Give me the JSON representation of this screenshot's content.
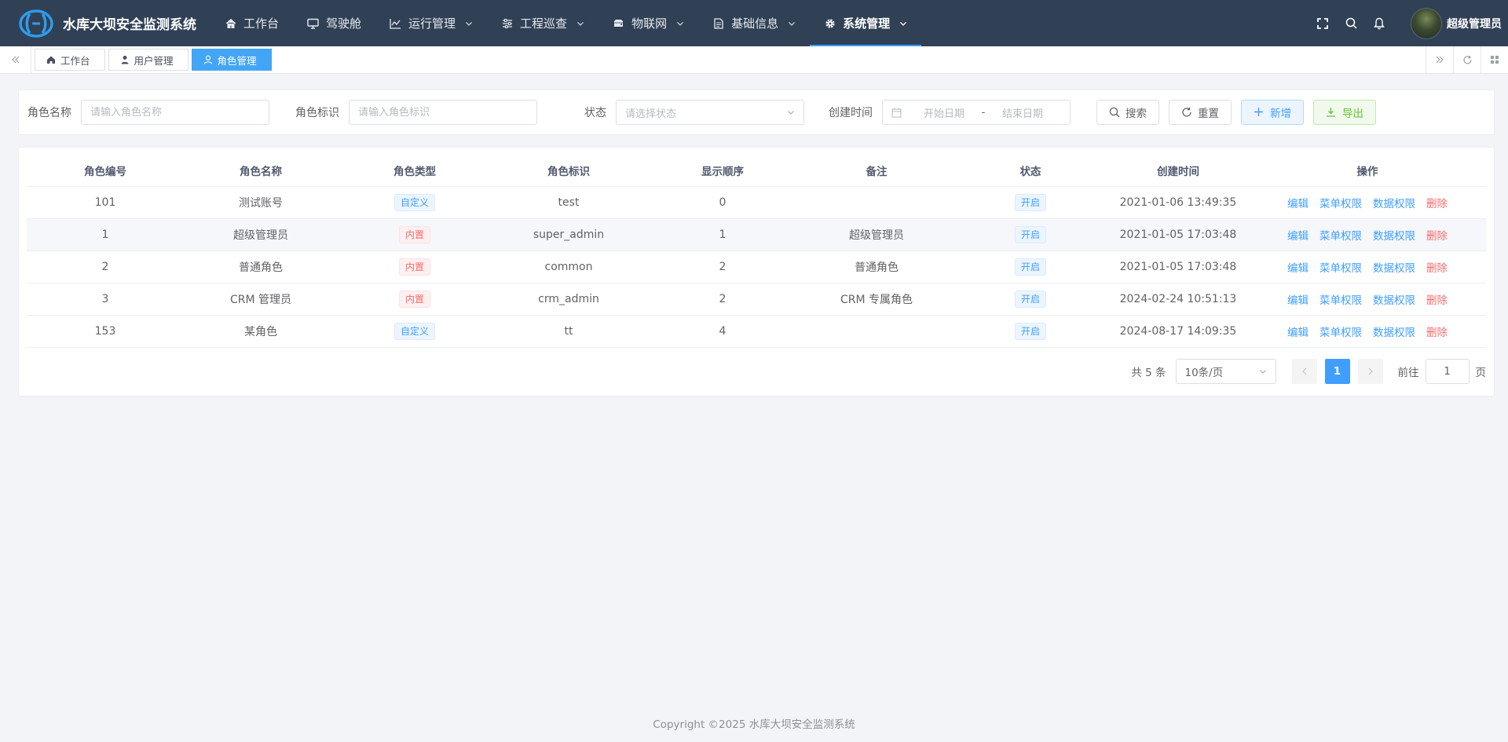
{
  "app": {
    "title": "水库大坝安全监测系统"
  },
  "nav": [
    {
      "label": "工作台",
      "icon": "home-icon",
      "dropdown": false
    },
    {
      "label": "驾驶舱",
      "icon": "monitor-icon",
      "dropdown": false
    },
    {
      "label": "运行管理",
      "icon": "chart-line-icon",
      "dropdown": true
    },
    {
      "label": "工程巡查",
      "icon": "sliders-icon",
      "dropdown": true
    },
    {
      "label": "物联网",
      "icon": "server-icon",
      "dropdown": true
    },
    {
      "label": "基础信息",
      "icon": "document-icon",
      "dropdown": true
    },
    {
      "label": "系统管理",
      "icon": "gear-icon",
      "dropdown": true,
      "active": true
    }
  ],
  "user": {
    "name": "超级管理员"
  },
  "tags": [
    {
      "label": "工作台",
      "icon": "home-icon"
    },
    {
      "label": "用户管理",
      "icon": "user-icon"
    },
    {
      "label": "角色管理",
      "icon": "user-outline-icon",
      "active": true
    }
  ],
  "filter": {
    "role_name": {
      "label": "角色名称",
      "placeholder": "请输入角色名称"
    },
    "role_key": {
      "label": "角色标识",
      "placeholder": "请输入角色标识"
    },
    "status": {
      "label": "状态",
      "placeholder": "请选择状态"
    },
    "created": {
      "label": "创建时间",
      "start_placeholder": "开始日期",
      "separator": "-",
      "end_placeholder": "结束日期"
    },
    "buttons": {
      "search": "搜索",
      "reset": "重置",
      "add": "新增",
      "export": "导出"
    }
  },
  "table": {
    "columns": [
      "角色编号",
      "角色名称",
      "角色类型",
      "角色标识",
      "显示顺序",
      "备注",
      "状态",
      "创建时间",
      "操作"
    ],
    "rows": [
      {
        "id": "101",
        "name": "测试账号",
        "type": "自定义",
        "type_color": "blue",
        "key": "test",
        "order": "0",
        "remark": "",
        "status": "开启",
        "created": "2021-01-06 13:49:35"
      },
      {
        "id": "1",
        "name": "超级管理员",
        "type": "内置",
        "type_color": "red",
        "key": "super_admin",
        "order": "1",
        "remark": "超级管理员",
        "status": "开启",
        "created": "2021-01-05 17:03:48"
      },
      {
        "id": "2",
        "name": "普通角色",
        "type": "内置",
        "type_color": "red",
        "key": "common",
        "order": "2",
        "remark": "普通角色",
        "status": "开启",
        "created": "2021-01-05 17:03:48"
      },
      {
        "id": "3",
        "name": "CRM 管理员",
        "type": "内置",
        "type_color": "red",
        "key": "crm_admin",
        "order": "2",
        "remark": "CRM 专属角色",
        "status": "开启",
        "created": "2024-02-24 10:51:13"
      },
      {
        "id": "153",
        "name": "某角色",
        "type": "自定义",
        "type_color": "blue",
        "key": "tt",
        "order": "4",
        "remark": "",
        "status": "开启",
        "created": "2024-08-17 14:09:35"
      }
    ],
    "actions": {
      "edit": "编辑",
      "menu_perm": "菜单权限",
      "data_perm": "数据权限",
      "delete": "删除"
    }
  },
  "pagination": {
    "total_text": "共 5 条",
    "page_size": "10条/页",
    "current_page": "1",
    "goto_label": "前往",
    "goto_value": "1",
    "page_suffix": "页"
  },
  "footer": {
    "copyright": "Copyright ©2025 水库大坝安全监测系统"
  },
  "colors": {
    "header_bg": "#304156",
    "primary": "#409eff",
    "danger": "#f56c6c",
    "success": "#67c23a",
    "page_bg": "#f3f4f7"
  }
}
